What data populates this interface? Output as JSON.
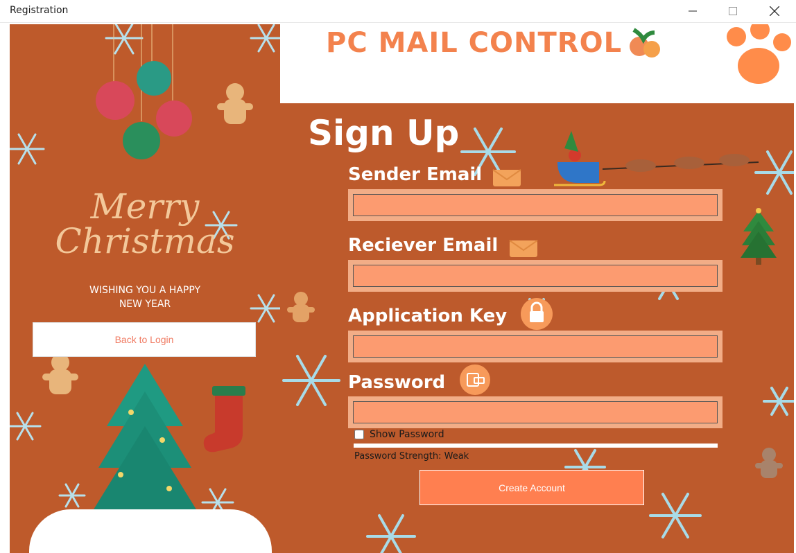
{
  "window": {
    "title": "Registration",
    "controls": {
      "minimize": "minimize-icon",
      "maximize": "maximize-icon",
      "close": "close-icon"
    }
  },
  "banner": {
    "title": "PC MAIL CONTROL"
  },
  "left_panel": {
    "greeting_line1": "Merry",
    "greeting_line2": "Christmas",
    "wish_line1": "WISHING YOU A HAPPY",
    "wish_line2": "NEW YEAR",
    "back_button_label": "Back to Login"
  },
  "form": {
    "heading": "Sign Up",
    "sender_email": {
      "label": "Sender Email",
      "value": ""
    },
    "receiver_email": {
      "label": "Reciever Email",
      "value": ""
    },
    "application_key": {
      "label": "Application Key",
      "value": ""
    },
    "password": {
      "label": "Password",
      "value": ""
    },
    "show_password_label": "Show Password",
    "show_password_checked": false,
    "strength_text": "Password Strength: Weak",
    "create_button_label": "Create Account"
  },
  "colors": {
    "background": "#bd5a2c",
    "field_border": "#f2ad87",
    "field_fill": "#fc9b70",
    "accent": "#ff7f50",
    "banner_text": "#f3824d"
  }
}
